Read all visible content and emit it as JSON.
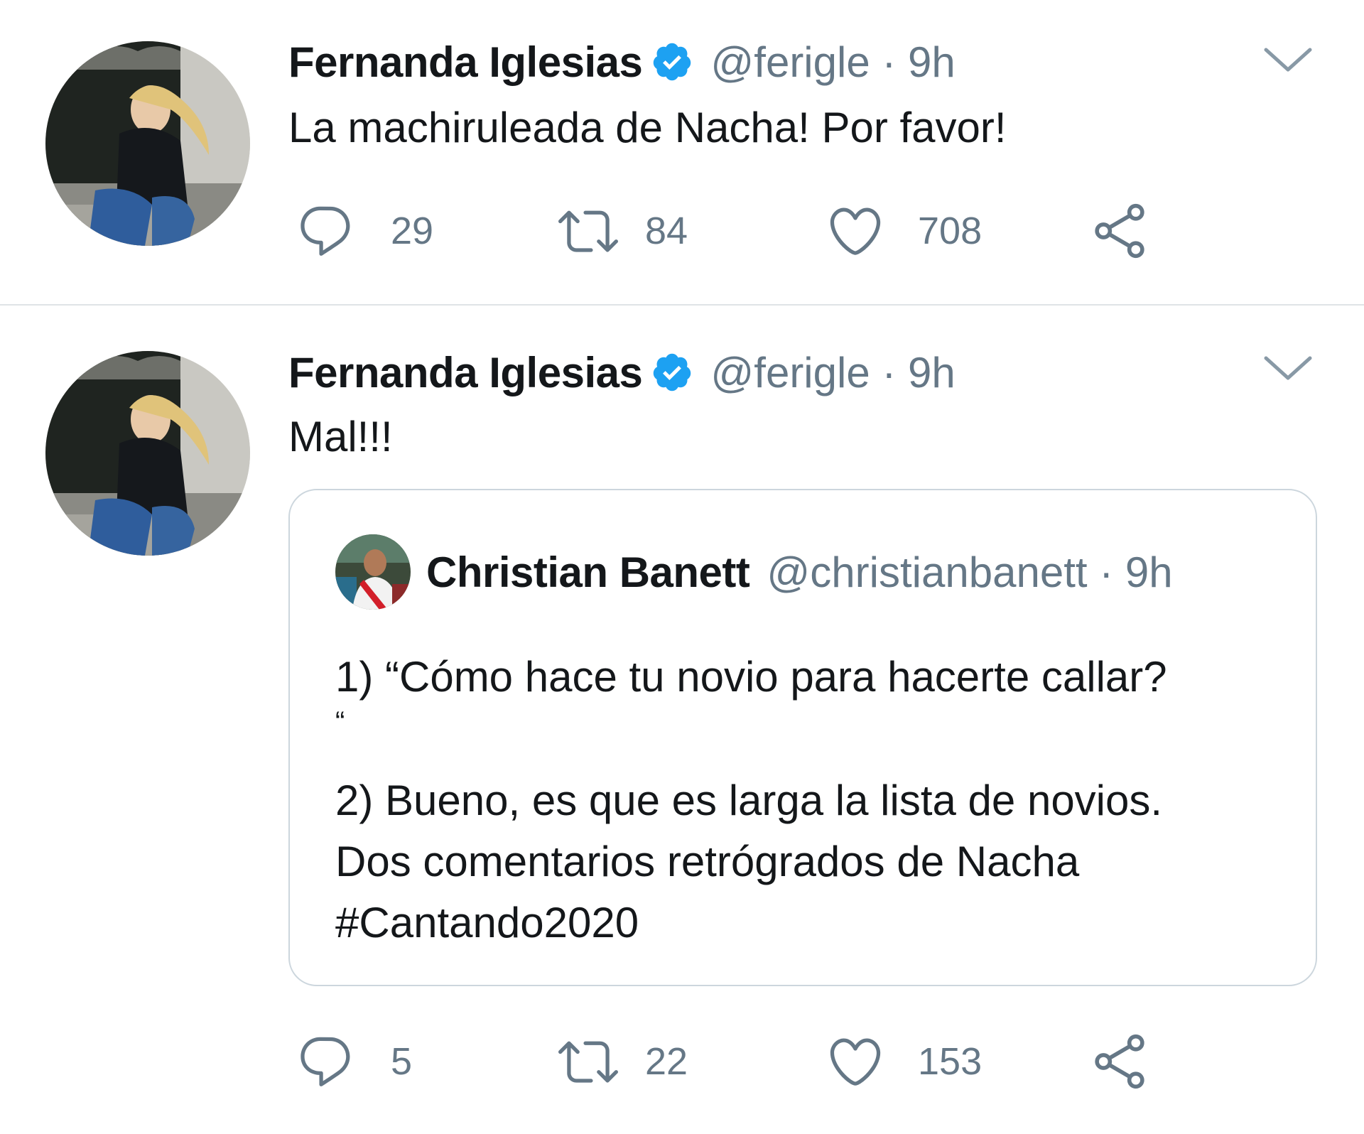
{
  "tweets": [
    {
      "author": {
        "name": "Fernanda Iglesias",
        "handle": "@ferigle",
        "time": "9h"
      },
      "text": "La machiruleada de Nacha! Por favor!",
      "stats": {
        "replies": "29",
        "retweets": "84",
        "likes": "708"
      }
    },
    {
      "author": {
        "name": "Fernanda Iglesias",
        "handle": "@ferigle",
        "time": "9h"
      },
      "text": "Mal!!!",
      "quoted": {
        "author": {
          "name": "Christian Banett",
          "handle": "@christianbanett",
          "time": "9h"
        },
        "lines": [
          "1) “Cómo hace tu novio para hacerte callar?",
          "“",
          "2) Bueno, es que es larga la lista de novios.",
          "Dos comentarios retrógrados de Nacha",
          "#Cantando2020"
        ]
      },
      "stats": {
        "replies": "5",
        "retweets": "22",
        "likes": "153"
      }
    }
  ],
  "colors": {
    "verified": "#1da1f2",
    "secondary_text": "#657786",
    "divider": "#dfe3e6"
  },
  "icons": [
    "verified-badge-icon",
    "chevron-down-icon",
    "reply-icon",
    "retweet-icon",
    "like-icon",
    "share-icon"
  ]
}
